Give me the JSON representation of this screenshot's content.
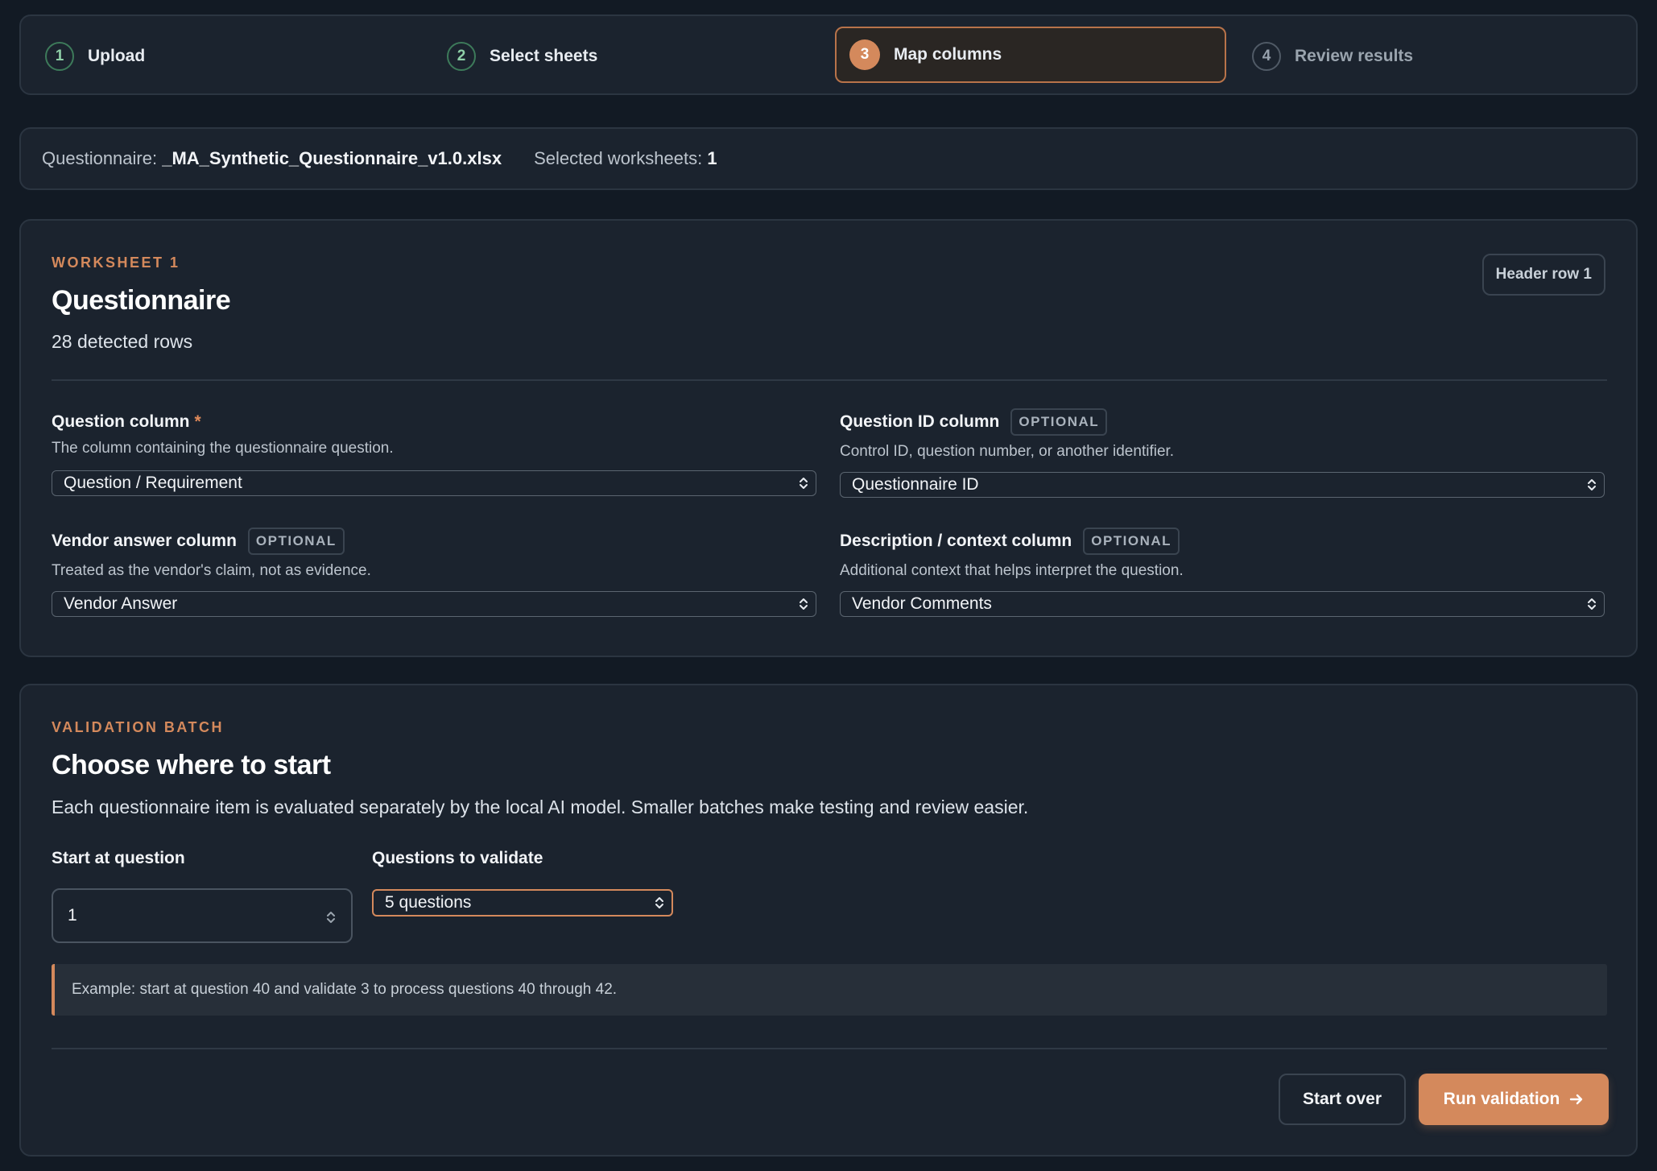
{
  "stepper": {
    "steps": [
      {
        "number": "1",
        "label": "Upload",
        "state": "done"
      },
      {
        "number": "2",
        "label": "Select sheets",
        "state": "done"
      },
      {
        "number": "3",
        "label": "Map columns",
        "state": "active"
      },
      {
        "number": "4",
        "label": "Review results",
        "state": "todo"
      }
    ]
  },
  "info": {
    "questionnaire_label": "Questionnaire:",
    "questionnaire_file": "_MA_Synthetic_Questionnaire_v1.0.xlsx",
    "worksheets_label": "Selected worksheets:",
    "worksheets_count": "1"
  },
  "worksheet": {
    "eyebrow": "WORKSHEET 1",
    "title": "Questionnaire",
    "rows_text": "28 detected rows",
    "header_row_button": "Header row 1",
    "fields": {
      "question": {
        "label": "Question column",
        "required_mark": "*",
        "help": "The column containing the questionnaire question.",
        "value": "Question / Requirement"
      },
      "question_id": {
        "label": "Question ID column",
        "badge": "OPTIONAL",
        "help": "Control ID, question number, or another identifier.",
        "value": "Questionnaire ID"
      },
      "vendor_answer": {
        "label": "Vendor answer column",
        "badge": "OPTIONAL",
        "help": "Treated as the vendor's claim, not as evidence.",
        "value": "Vendor Answer"
      },
      "description": {
        "label": "Description / context column",
        "badge": "OPTIONAL",
        "help": "Additional context that helps interpret the question.",
        "value": "Vendor Comments"
      }
    }
  },
  "batch": {
    "eyebrow": "VALIDATION BATCH",
    "title": "Choose where to start",
    "description": "Each questionnaire item is evaluated separately by the local AI model. Smaller batches make testing and review easier.",
    "start_label": "Start at question",
    "start_value": "1",
    "count_label": "Questions to validate",
    "count_value": "5 questions",
    "example": "Example: start at question 40 and validate 3 to process questions 40 through 42.",
    "start_over_button": "Start over",
    "run_button": "Run validation"
  },
  "colors": {
    "accent": "#d4895c",
    "background": "#121a24",
    "panel": "#1b232e",
    "done_step": "#3d7a5a"
  },
  "icons": {
    "select_chevron": "chevron-up-down-icon",
    "run_arrow": "arrow-right-icon"
  }
}
